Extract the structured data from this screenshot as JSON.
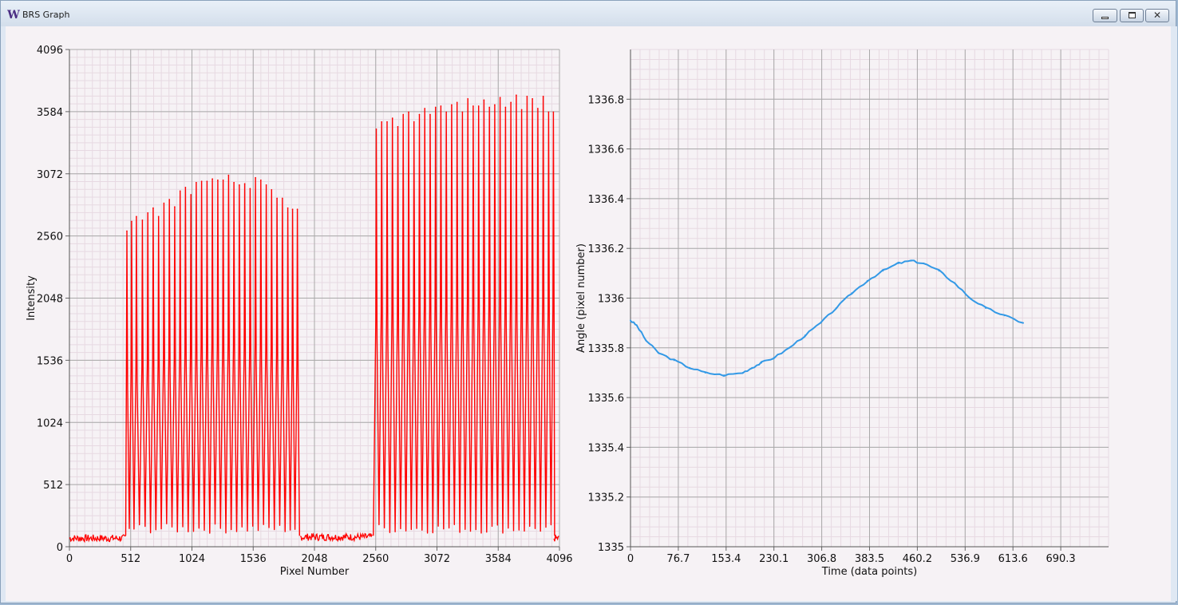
{
  "window": {
    "title": "BRS Graph",
    "icon": "W-logo-icon",
    "controls": [
      "minimize-icon",
      "restore-icon",
      "close-icon"
    ]
  },
  "colors": {
    "plot_background": "#f6f2f5",
    "major_grid": "#a9a9a9",
    "minor_grid": "#e7d9e2",
    "intensity_series": "#ff0000",
    "angle_series": "#3399e6"
  },
  "chart_data": [
    {
      "type": "line",
      "title": "",
      "xlabel": "Pixel Number",
      "ylabel": "Intensity",
      "xlim": [
        0,
        4096
      ],
      "ylim": [
        0,
        4096
      ],
      "xticks": [
        "0",
        "512",
        "1024",
        "1536",
        "2048",
        "2560",
        "3072",
        "3584",
        "4096"
      ],
      "yticks": [
        "0",
        "512",
        "1024",
        "1536",
        "2048",
        "2560",
        "3072",
        "3584",
        "4096"
      ],
      "grid": true,
      "noise_floor": [
        {
          "x_from": 0,
          "x_to": 470,
          "level": 70
        },
        {
          "x_from": 1930,
          "x_to": 2530,
          "level": 80
        },
        {
          "x_from": 4050,
          "x_to": 4096,
          "level": 70
        }
      ],
      "baseline_between_peaks": 150,
      "peaks": [
        {
          "x": 480,
          "y": 2600
        },
        {
          "x": 520,
          "y": 2680
        },
        {
          "x": 560,
          "y": 2720
        },
        {
          "x": 610,
          "y": 2690
        },
        {
          "x": 655,
          "y": 2750
        },
        {
          "x": 700,
          "y": 2790
        },
        {
          "x": 745,
          "y": 2720
        },
        {
          "x": 790,
          "y": 2830
        },
        {
          "x": 835,
          "y": 2860
        },
        {
          "x": 880,
          "y": 2800
        },
        {
          "x": 925,
          "y": 2930
        },
        {
          "x": 970,
          "y": 2960
        },
        {
          "x": 1015,
          "y": 2900
        },
        {
          "x": 1060,
          "y": 3000
        },
        {
          "x": 1105,
          "y": 3010
        },
        {
          "x": 1150,
          "y": 3010
        },
        {
          "x": 1195,
          "y": 3030
        },
        {
          "x": 1240,
          "y": 3020
        },
        {
          "x": 1285,
          "y": 3020
        },
        {
          "x": 1330,
          "y": 3060
        },
        {
          "x": 1375,
          "y": 3000
        },
        {
          "x": 1420,
          "y": 2980
        },
        {
          "x": 1465,
          "y": 2990
        },
        {
          "x": 1510,
          "y": 2950
        },
        {
          "x": 1555,
          "y": 3040
        },
        {
          "x": 1600,
          "y": 3020
        },
        {
          "x": 1645,
          "y": 2980
        },
        {
          "x": 1690,
          "y": 2940
        },
        {
          "x": 1735,
          "y": 2870
        },
        {
          "x": 1780,
          "y": 2870
        },
        {
          "x": 1825,
          "y": 2790
        },
        {
          "x": 1865,
          "y": 2780
        },
        {
          "x": 1905,
          "y": 2780
        },
        {
          "x": 2565,
          "y": 3440
        },
        {
          "x": 2610,
          "y": 3500
        },
        {
          "x": 2655,
          "y": 3500
        },
        {
          "x": 2700,
          "y": 3530
        },
        {
          "x": 2745,
          "y": 3460
        },
        {
          "x": 2790,
          "y": 3560
        },
        {
          "x": 2835,
          "y": 3580
        },
        {
          "x": 2880,
          "y": 3500
        },
        {
          "x": 2925,
          "y": 3560
        },
        {
          "x": 2970,
          "y": 3610
        },
        {
          "x": 3015,
          "y": 3560
        },
        {
          "x": 3060,
          "y": 3620
        },
        {
          "x": 3105,
          "y": 3630
        },
        {
          "x": 3150,
          "y": 3580
        },
        {
          "x": 3195,
          "y": 3640
        },
        {
          "x": 3240,
          "y": 3660
        },
        {
          "x": 3285,
          "y": 3580
        },
        {
          "x": 3330,
          "y": 3690
        },
        {
          "x": 3375,
          "y": 3630
        },
        {
          "x": 3420,
          "y": 3630
        },
        {
          "x": 3465,
          "y": 3680
        },
        {
          "x": 3510,
          "y": 3620
        },
        {
          "x": 3555,
          "y": 3640
        },
        {
          "x": 3600,
          "y": 3700
        },
        {
          "x": 3645,
          "y": 3620
        },
        {
          "x": 3690,
          "y": 3660
        },
        {
          "x": 3735,
          "y": 3720
        },
        {
          "x": 3780,
          "y": 3600
        },
        {
          "x": 3825,
          "y": 3710
        },
        {
          "x": 3870,
          "y": 3690
        },
        {
          "x": 3915,
          "y": 3610
        },
        {
          "x": 3960,
          "y": 3710
        },
        {
          "x": 4005,
          "y": 3580
        },
        {
          "x": 4045,
          "y": 3580
        }
      ]
    },
    {
      "type": "line",
      "title": "",
      "xlabel": "Time (data points)",
      "ylabel": "Angle (pixel number)",
      "xlim": [
        0,
        767
      ],
      "ylim": [
        1335,
        1337
      ],
      "xticks": [
        "0",
        "76.7",
        "153.4",
        "230.1",
        "306.8",
        "383.5",
        "460.2",
        "536.9",
        "613.6",
        "690.3"
      ],
      "yticks": [
        "1335",
        "1335.2",
        "1335.4",
        "1335.6",
        "1335.8",
        "1336",
        "1336.2",
        "1336.4",
        "1336.6",
        "1336.8"
      ],
      "grid": true,
      "x": [
        0,
        10,
        25,
        45,
        70,
        95,
        120,
        150,
        180,
        195,
        210,
        230,
        255,
        280,
        305,
        330,
        355,
        380,
        405,
        430,
        450,
        470,
        495,
        520,
        545,
        570,
        600,
        630
      ],
      "y": [
        1335.91,
        1335.89,
        1335.83,
        1335.78,
        1335.75,
        1335.72,
        1335.7,
        1335.69,
        1335.7,
        1335.72,
        1335.74,
        1335.76,
        1335.8,
        1335.85,
        1335.9,
        1335.96,
        1336.02,
        1336.07,
        1336.11,
        1336.14,
        1336.15,
        1336.14,
        1336.11,
        1336.06,
        1336.0,
        1335.96,
        1335.93,
        1335.9
      ]
    }
  ]
}
